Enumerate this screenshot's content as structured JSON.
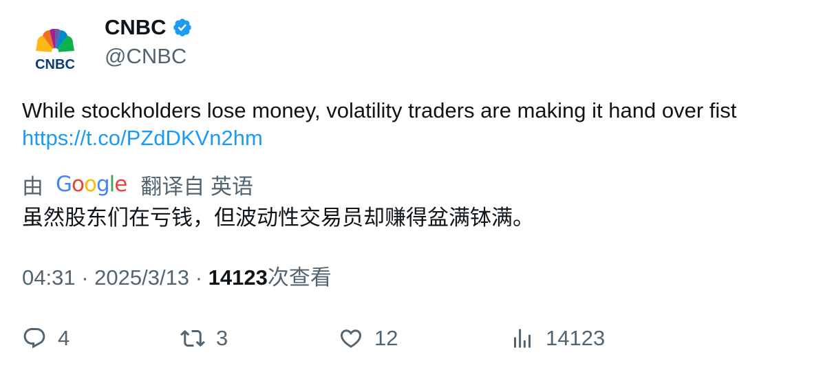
{
  "author": {
    "display_name": "CNBC",
    "handle": "@CNBC",
    "avatar_wordmark": "CNBC",
    "verified_icon": "verified-badge-icon"
  },
  "tweet": {
    "text": "While stockholders lose money, volatility traders are making it hand over fist",
    "link": "https://t.co/PZdDKVn2hm"
  },
  "translation": {
    "prefix": "由",
    "provider": "Google",
    "suffix": "翻译自 英语",
    "text": "虽然股东们在亏钱，但波动性交易员却赚得盆满钵满。"
  },
  "meta": {
    "time": "04:31",
    "separator": "·",
    "date": "2025/3/13",
    "views_count": "14123",
    "views_label": "次查看"
  },
  "actions": {
    "reply": {
      "icon": "reply-icon",
      "count": "4"
    },
    "retweet": {
      "icon": "retweet-icon",
      "count": "3"
    },
    "like": {
      "icon": "heart-icon",
      "count": "12"
    },
    "views": {
      "icon": "analytics-icon",
      "count": "14123"
    }
  },
  "colors": {
    "link": "#1d9bf0",
    "verified": "#1d9bf0",
    "secondary_text": "#536471",
    "primary_text": "#0f1419"
  }
}
